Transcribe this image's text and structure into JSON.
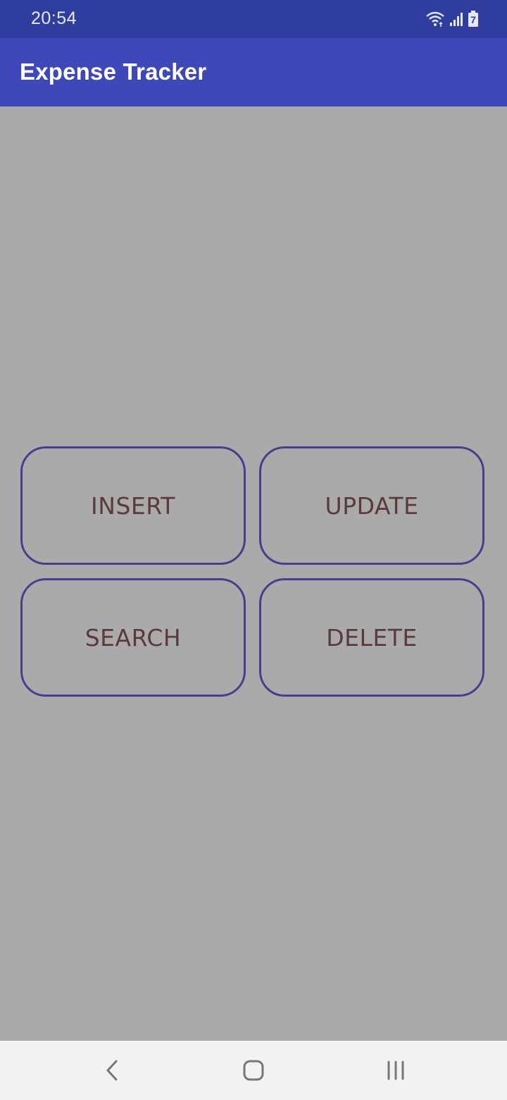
{
  "status_bar": {
    "time": "20:54",
    "icons": [
      "wifi-icon",
      "signal-icon",
      "battery-icon"
    ],
    "battery_level_text": "7"
  },
  "app_bar": {
    "title": "Expense Tracker",
    "background_color": "#3f48b8"
  },
  "actions": {
    "insert_label": "INSERT",
    "update_label": "UPDATE",
    "search_label": "SEARCH",
    "delete_label": "DELETE",
    "border_color": "#4f3b8e",
    "text_color": "#5a3a3a"
  },
  "nav_bar": {
    "icons": [
      "back-icon",
      "home-icon",
      "recent-apps-icon"
    ]
  }
}
